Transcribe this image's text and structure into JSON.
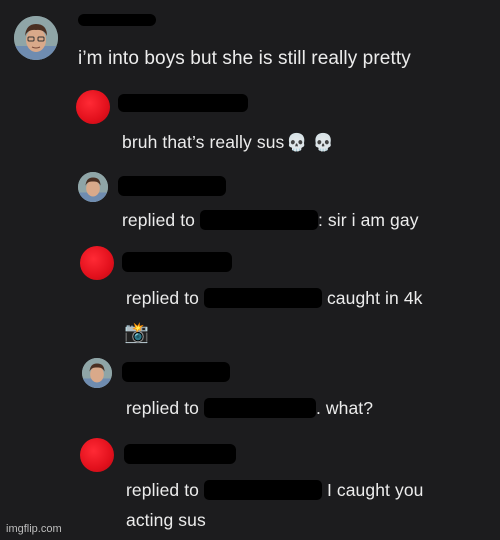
{
  "comments": [
    {
      "avatar": "cartoon-boy-avatar",
      "text": "i’m into boys but she is still really pretty"
    },
    {
      "avatar": "red-circle-avatar",
      "text": "bruh that’s really sus",
      "emoji": "💀 💀"
    },
    {
      "avatar": "cartoon-boy-avatar",
      "prefix": "replied to",
      "suffix": ": sir i am gay"
    },
    {
      "avatar": "red-circle-avatar",
      "prefix": "replied to",
      "suffix": "caught in 4k",
      "emoji": "📸"
    },
    {
      "avatar": "cartoon-boy-avatar",
      "prefix": "replied to",
      "suffix": ". what?"
    },
    {
      "avatar": "red-circle-avatar",
      "prefix": "replied to",
      "suffix": "I caught you",
      "line2": "acting sus"
    }
  ],
  "watermark": "imgflip.com",
  "colors": {
    "background": "#1c1c1e",
    "text": "#ececec",
    "red_avatar": "#e2101c",
    "redaction": "#000000"
  }
}
